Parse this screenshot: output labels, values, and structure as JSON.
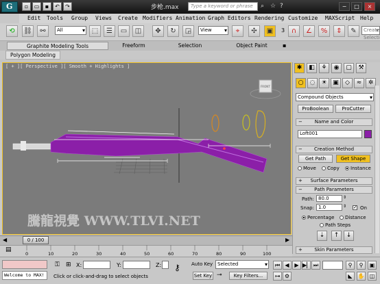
{
  "window": {
    "title": "步枪.max",
    "search_placeholder": "Type a keyword or phrase",
    "min": "−",
    "max": "□",
    "close": "×"
  },
  "menu": [
    "Edit",
    "Tools",
    "Group",
    "Views",
    "Create",
    "Modifiers",
    "Animation",
    "Graph Editors",
    "Rendering",
    "Customize",
    "MAXScript",
    "Help"
  ],
  "toolbar": {
    "selection_filter": "All",
    "ref_coord": "View",
    "snap_num": "3",
    "named_sel_placeholder": "Create Selection"
  },
  "ribbon": {
    "tabs": [
      "Graphite Modeling Tools",
      "Freeform",
      "Selection",
      "Object Paint"
    ],
    "active_tab": "Graphite Modeling Tools",
    "sub_tab": "Polygon Modeling"
  },
  "viewport": {
    "label": "[ + ][ Perspective ][ Smooth + Highlights ]",
    "viewcube_label": "FRONT",
    "watermark": "騰龍視覺 WWW.TLVI.NET"
  },
  "command_panel": {
    "category": "Compound Objects",
    "buttons": [
      "ProBoolean",
      "ProCutter"
    ],
    "name_color_header": "Name and Color",
    "object_name": "Loft001",
    "object_color": "#8b1fa8",
    "creation_method_header": "Creation Method",
    "get_path": "Get Path",
    "get_shape": "Get Shape",
    "move": "Move",
    "copy": "Copy",
    "instance": "Instance",
    "surface_params": "Surface Parameters",
    "path_params": "Path Parameters",
    "path_label": "Path:",
    "path_value": "80.0",
    "snap_label": "Snap:",
    "snap_value": "1.0",
    "on_label": "On",
    "percentage": "Percentage",
    "distance": "Distance",
    "path_steps": "Path Steps",
    "skin_params": "Skin Parameters",
    "plus": "+",
    "minus": "−"
  },
  "timeline": {
    "frame": "0 / 100",
    "ticks": [
      "0",
      "10",
      "20",
      "30",
      "40",
      "50",
      "60",
      "70",
      "80",
      "90",
      "100"
    ]
  },
  "status": {
    "welcome": "Welcome to MAX!",
    "prompt": "Click or click-and-drag to select objects",
    "x_label": "X:",
    "y_label": "Y:",
    "z_label": "Z:",
    "auto_key": "Auto Key",
    "set_key": "Set Key",
    "key_mode": "Selected",
    "key_filters": "Key Filters..."
  },
  "colors": {
    "accent": "#f0c020",
    "purple_object": "#8b1fa8",
    "viewport_bg": "#7b7b7b"
  }
}
